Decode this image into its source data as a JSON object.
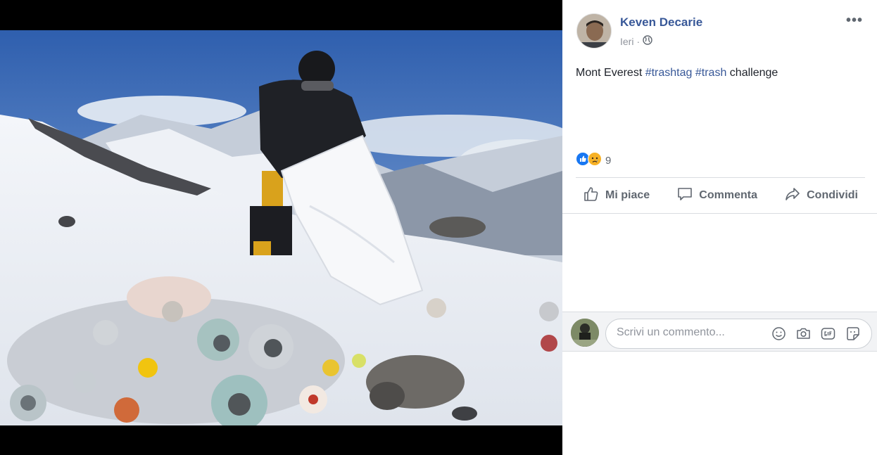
{
  "post": {
    "author": "Keven Decarie",
    "time": "Ieri",
    "time_separator": "·",
    "text_prefix": "Mont Everest ",
    "hashtag1": "#trashtag",
    "hashtag2": "#trash",
    "text_suffix": " challenge",
    "reaction_count": "9",
    "more_label": "•••"
  },
  "actions": {
    "like": "Mi piace",
    "comment": "Commenta",
    "share": "Condividi"
  },
  "comment_box": {
    "placeholder": "Scrivi un commento..."
  },
  "colors": {
    "link": "#385898",
    "like_blue": "#1877f2",
    "sad_yellow": "#f7b125"
  }
}
